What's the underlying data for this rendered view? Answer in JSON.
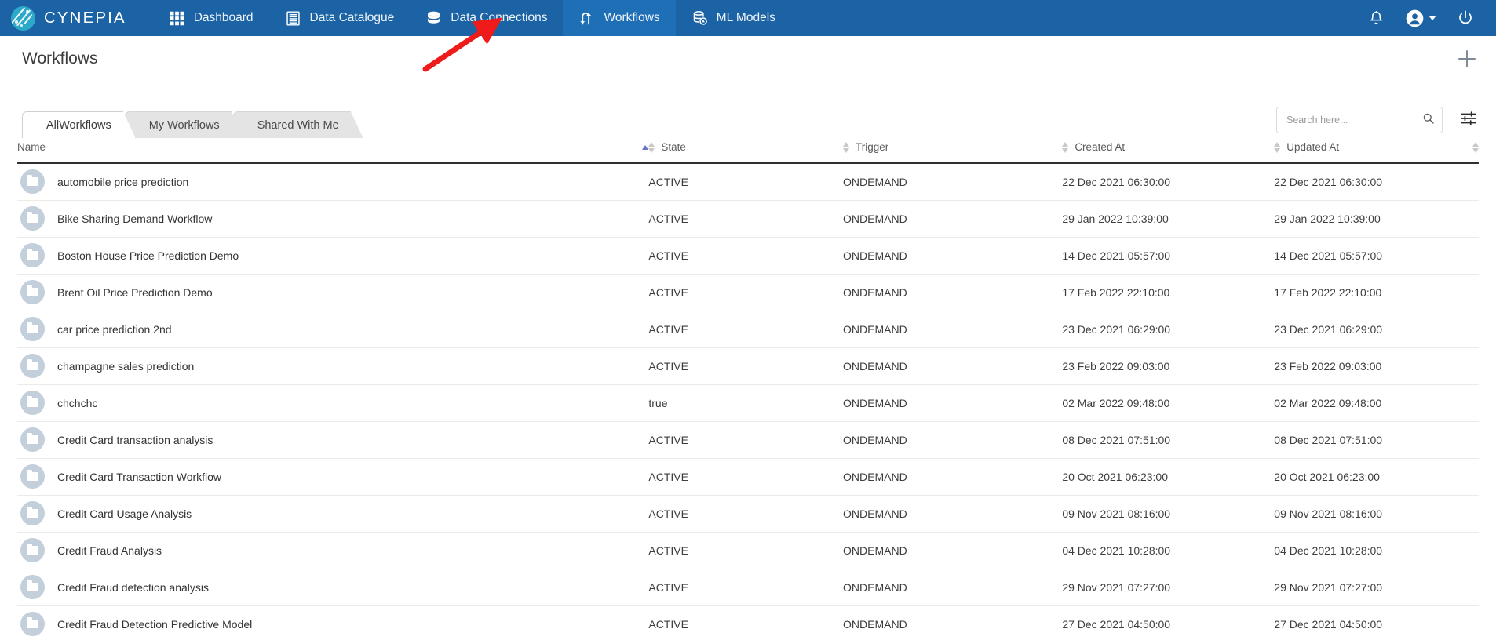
{
  "brand": {
    "name": "CYNEPIA",
    "logo_icon": "cynepia-circle-logo"
  },
  "nav": {
    "items": [
      {
        "label": "Dashboard",
        "icon": "grid-icon",
        "active": false
      },
      {
        "label": "Data Catalogue",
        "icon": "document-icon",
        "active": false
      },
      {
        "label": "Data Connections",
        "icon": "database-icon",
        "active": false
      },
      {
        "label": "Workflows",
        "icon": "workflow-icon",
        "active": true
      },
      {
        "label": "ML Models",
        "icon": "ml-model-icon",
        "active": false
      }
    ],
    "right": [
      {
        "name": "notifications-bell-icon"
      },
      {
        "name": "user-avatar-icon"
      },
      {
        "name": "power-logout-icon"
      }
    ]
  },
  "page": {
    "title": "Workflows",
    "add_button_label": "+"
  },
  "tabs": [
    {
      "label": "AllWorkflows",
      "active": true
    },
    {
      "label": "My Workflows",
      "active": false
    },
    {
      "label": "Shared With Me",
      "active": false
    }
  ],
  "search": {
    "value": "",
    "placeholder": "Search here...",
    "icon": "search-icon",
    "filter_icon": "filter-sliders-icon"
  },
  "table": {
    "columns": [
      {
        "label": "Name",
        "sort": "asc"
      },
      {
        "label": "State",
        "sort": "none"
      },
      {
        "label": "Trigger",
        "sort": "none"
      },
      {
        "label": "Created At",
        "sort": "none"
      },
      {
        "label": "Updated At",
        "sort": "none"
      }
    ],
    "rows": [
      {
        "name": "automobile price prediction",
        "state": "ACTIVE",
        "trigger": "ONDEMAND",
        "created": "22 Dec 2021 06:30:00",
        "updated": "22 Dec 2021 06:30:00"
      },
      {
        "name": "Bike Sharing Demand Workflow",
        "state": "ACTIVE",
        "trigger": "ONDEMAND",
        "created": "29 Jan 2022 10:39:00",
        "updated": "29 Jan 2022 10:39:00"
      },
      {
        "name": "Boston House Price Prediction Demo",
        "state": "ACTIVE",
        "trigger": "ONDEMAND",
        "created": "14 Dec 2021 05:57:00",
        "updated": "14 Dec 2021 05:57:00"
      },
      {
        "name": "Brent Oil Price Prediction Demo",
        "state": "ACTIVE",
        "trigger": "ONDEMAND",
        "created": "17 Feb 2022 22:10:00",
        "updated": "17 Feb 2022 22:10:00"
      },
      {
        "name": "car price prediction 2nd",
        "state": "ACTIVE",
        "trigger": "ONDEMAND",
        "created": "23 Dec 2021 06:29:00",
        "updated": "23 Dec 2021 06:29:00"
      },
      {
        "name": "champagne sales prediction",
        "state": "ACTIVE",
        "trigger": "ONDEMAND",
        "created": "23 Feb 2022 09:03:00",
        "updated": "23 Feb 2022 09:03:00"
      },
      {
        "name": "chchchc",
        "state": "true",
        "trigger": "ONDEMAND",
        "created": "02 Mar 2022 09:48:00",
        "updated": "02 Mar 2022 09:48:00"
      },
      {
        "name": "Credit Card transaction analysis",
        "state": "ACTIVE",
        "trigger": "ONDEMAND",
        "created": "08 Dec 2021 07:51:00",
        "updated": "08 Dec 2021 07:51:00"
      },
      {
        "name": "Credit Card Transaction Workflow",
        "state": "ACTIVE",
        "trigger": "ONDEMAND",
        "created": "20 Oct 2021 06:23:00",
        "updated": "20 Oct 2021 06:23:00"
      },
      {
        "name": "Credit Card Usage Analysis",
        "state": "ACTIVE",
        "trigger": "ONDEMAND",
        "created": "09 Nov 2021 08:16:00",
        "updated": "09 Nov 2021 08:16:00"
      },
      {
        "name": "Credit Fraud Analysis",
        "state": "ACTIVE",
        "trigger": "ONDEMAND",
        "created": "04 Dec 2021 10:28:00",
        "updated": "04 Dec 2021 10:28:00"
      },
      {
        "name": "Credit Fraud detection analysis",
        "state": "ACTIVE",
        "trigger": "ONDEMAND",
        "created": "29 Nov 2021 07:27:00",
        "updated": "29 Nov 2021 07:27:00"
      },
      {
        "name": "Credit Fraud Detection Predictive Model",
        "state": "ACTIVE",
        "trigger": "ONDEMAND",
        "created": "27 Dec 2021 04:50:00",
        "updated": "27 Dec 2021 04:50:00"
      }
    ]
  },
  "annotation": {
    "name": "red-arrow-pointing-to-workflows"
  },
  "colors": {
    "nav_background": "#1b63a5",
    "nav_active": "#1f6fb6",
    "logo_accent": "#2ea8c8",
    "sort_active": "#6a74c9",
    "avatar": "#c3cfda",
    "annotation_red": "#ef1b1b"
  }
}
